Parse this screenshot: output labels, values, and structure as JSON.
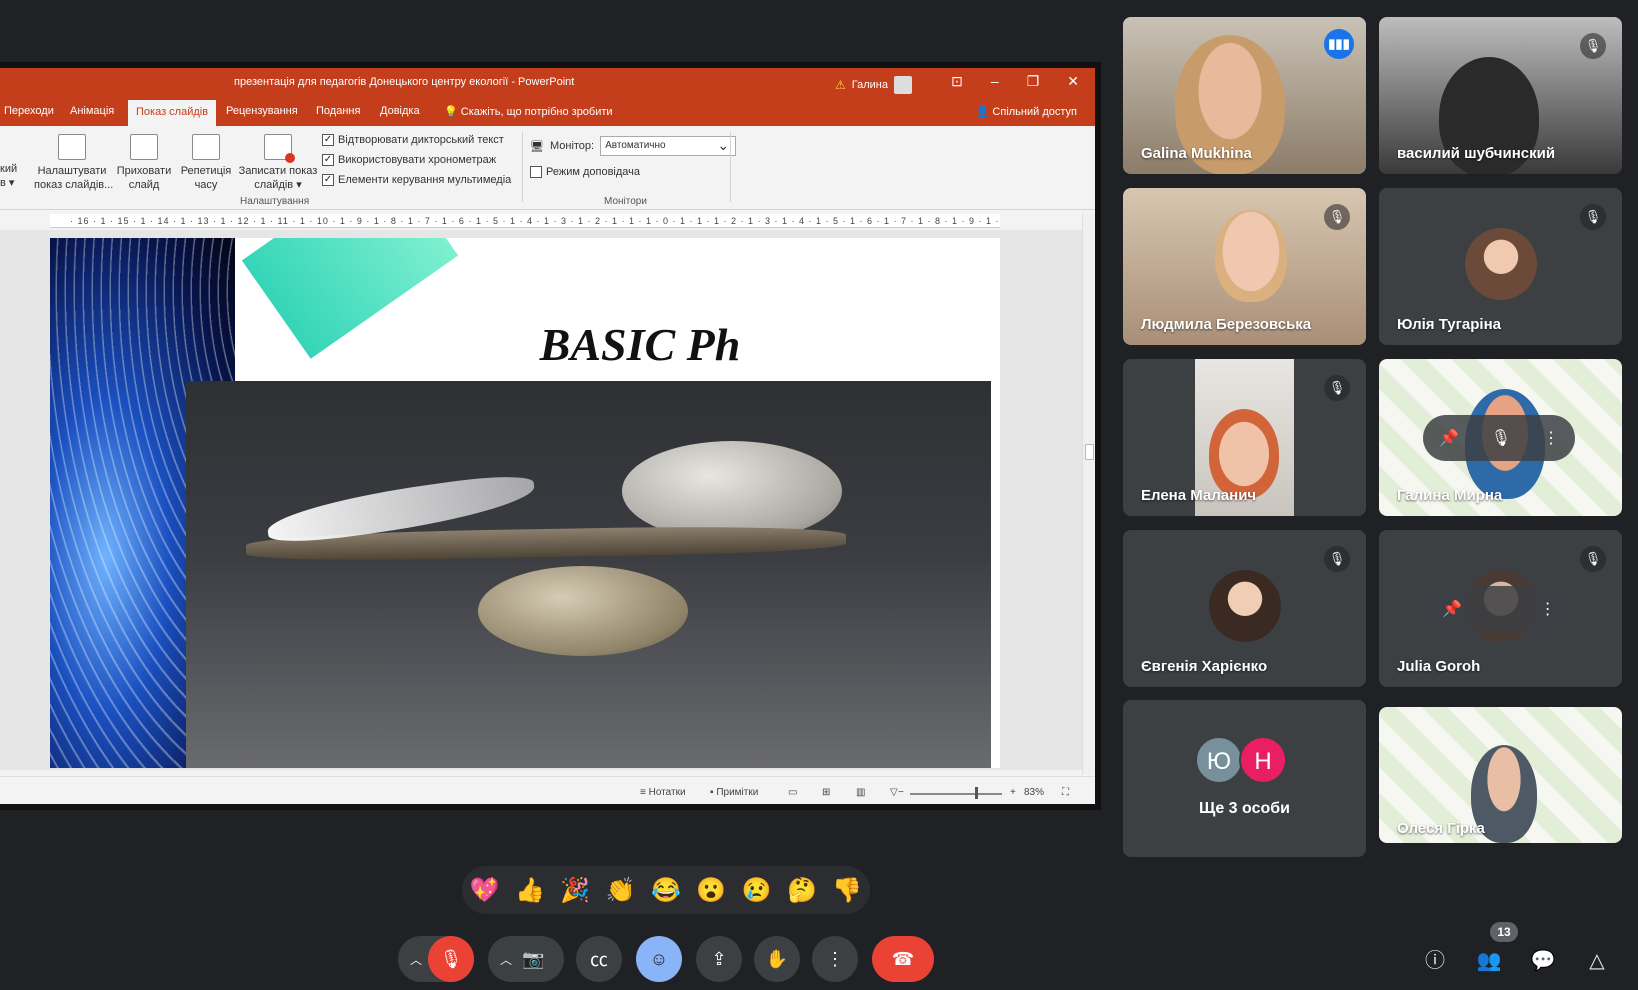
{
  "powerpoint": {
    "window_title": "презентація для педагогів Донецького центру екології - PowerPoint",
    "user_name": "Галина",
    "tabs": [
      "Переходи",
      "Анімація",
      "Показ слайдів",
      "Рецензування",
      "Подання",
      "Довідка"
    ],
    "active_tab": "Показ слайдів",
    "tell_me": "Скажіть, що потрібно зробити",
    "share": "Спільний доступ",
    "ribbon": {
      "partial_btn": "кий\nв ▾",
      "setup_show": "Налаштувати\nпоказ слайдів...",
      "hide_slide": "Приховати\nслайд",
      "rehearse": "Репетиція\nчасу",
      "record": "Записати показ\nслайдів ▾",
      "play_narrations": "Відтворювати дикторський текст",
      "use_timings": "Використовувати хронометраж",
      "media_controls": "Елементи керування мультимедіа",
      "group_setup": "Налаштування",
      "monitor_label": "Монітор:",
      "monitor_value": "Автоматично",
      "presenter_view": "Режим доповідача",
      "group_monitors": "Монітори"
    },
    "ruler": "· 16 · 1 · 15 · 1 · 14 · 1 · 13 · 1 · 12 · 1 · 11 · 1 · 10 · 1 · 9 · 1 · 8 · 1 · 7 · 1 · 6 · 1 · 5 · 1 · 4 · 1 · 3 · 1 · 2 · 1 · 1 · 1 · 0 · 1 · 1 · 1 · 2 · 1 · 3 · 1 · 4 · 1 · 5 · 1 · 6 · 1 · 7 · 1 · 8 · 1 · 9 · 1 · 10 · 1 · 11 · 1 · 12 · 1 · 13 · 1 · 14 · 1 · 15 · 1 · 16 ·",
    "slide_title": "BASIC Ph",
    "status": {
      "notes": "Нотатки",
      "comments": "Примітки",
      "zoom": "83%"
    }
  },
  "participants": [
    {
      "name": "Galina Mukhina",
      "speaking": true
    },
    {
      "name": "василий шубчинский",
      "muted": true
    },
    {
      "name": "Людмила Березовська",
      "muted": true
    },
    {
      "name": "Юлія Тугаріна",
      "muted": true
    },
    {
      "name": "Елена Маланич",
      "muted": true
    },
    {
      "name": "Галина Мирна",
      "muted": true
    },
    {
      "name": "Євгенія Харієнко",
      "muted": true
    },
    {
      "name": "Julia Goroh",
      "muted": true
    },
    {
      "name": "Олеся Гірка",
      "muted": true
    }
  ],
  "more_people": {
    "initials": [
      "Ю",
      "Н"
    ],
    "label": "Ще 3 особи"
  },
  "reactions": [
    "💖",
    "👍",
    "🎉",
    "👏",
    "😂",
    "😮",
    "😢",
    "🤔",
    "👎"
  ],
  "participant_count": "13",
  "colors": {
    "meet_bg": "#202124",
    "ppt_accent": "#c43e1c",
    "end_call": "#ea4335",
    "active_speaker": "#8ab4f8"
  }
}
